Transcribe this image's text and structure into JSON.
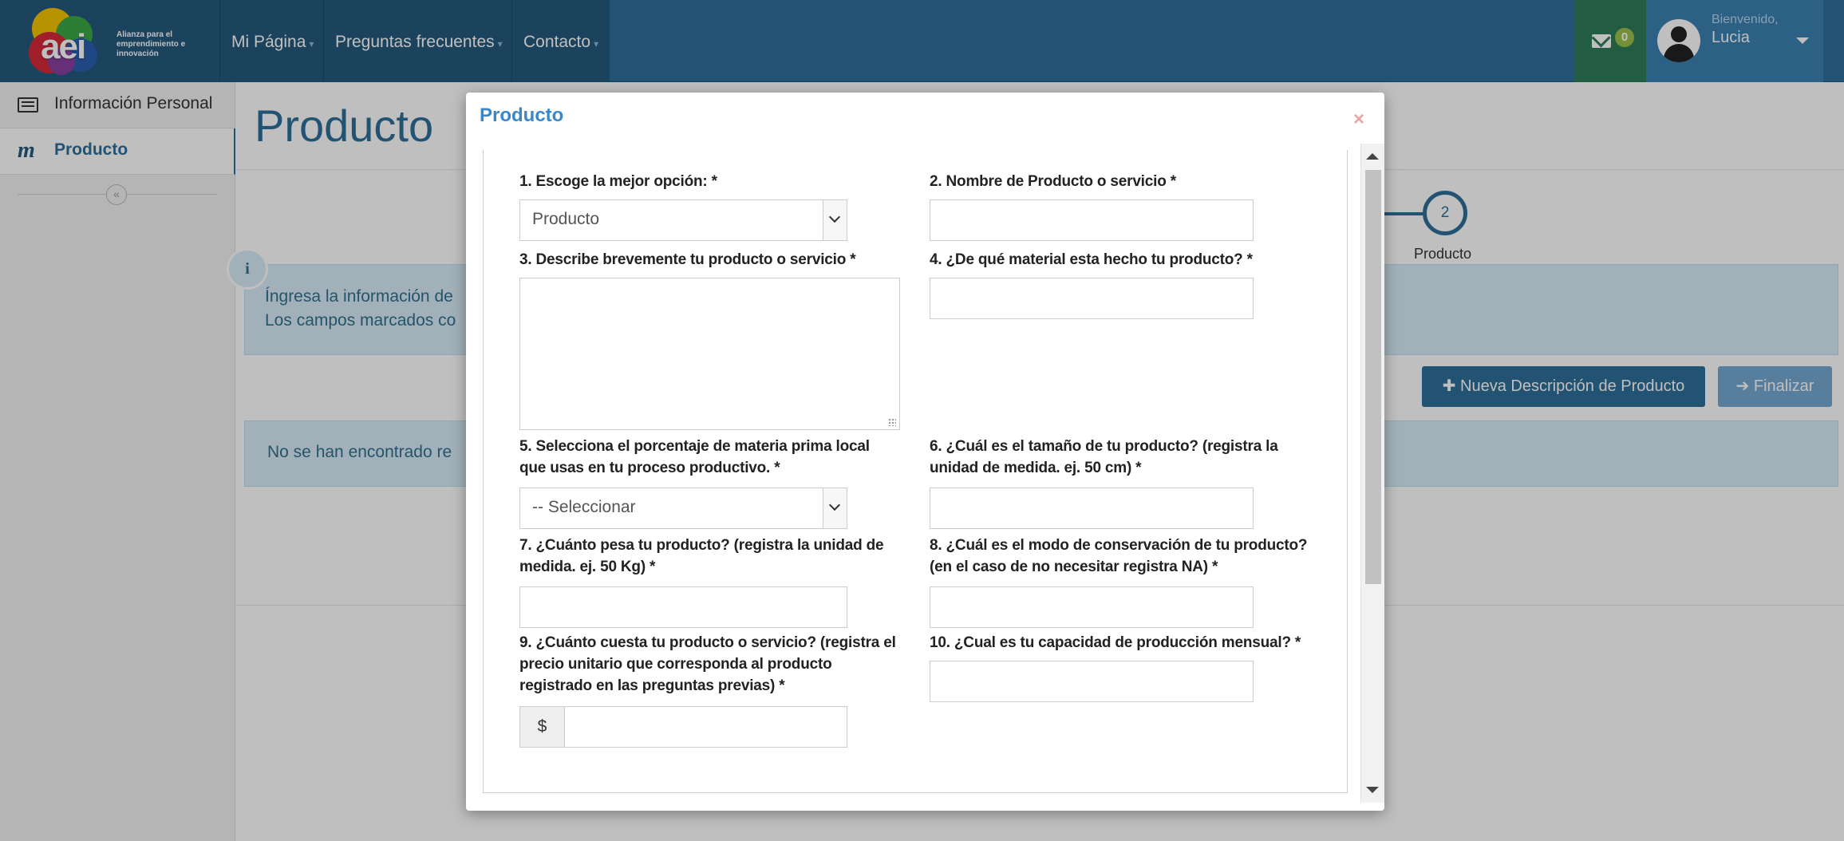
{
  "brand": {
    "logo_text": "aei",
    "tagline": "Alianza para el emprendimiento e innovación"
  },
  "nav": {
    "items": [
      {
        "label": "Mi Página"
      },
      {
        "label": "Preguntas frecuentes"
      },
      {
        "label": "Contacto"
      }
    ],
    "messages_count": "0",
    "welcome": "Bienvenido,",
    "user_name": "Lucia"
  },
  "sidebar": {
    "items": [
      {
        "label": "Información Personal"
      },
      {
        "label": "Producto"
      }
    ],
    "collapse_label": "«"
  },
  "page": {
    "title": "Producto",
    "step_number": "2",
    "step_label": "Producto",
    "info_icon": "i",
    "info_line1": "Íngresa la información de",
    "info_line2": "Los campos marcados co",
    "new_button": "Nueva Descripción de Producto",
    "finish_button": "Finalizar",
    "empty_text": "No se han encontrado re"
  },
  "modal": {
    "title": "Producto",
    "close": "×",
    "questions": {
      "q1": "1. Escoge la mejor opción: *",
      "q1_value": "Producto",
      "q2": "2. Nombre de Producto o servicio *",
      "q3": "3. Describe brevemente tu producto o servicio *",
      "q4": "4. ¿De qué material esta hecho tu producto? *",
      "q5_line1": "5. Selecciona el porcentaje de materia prima local",
      "q5_line2": "que usas en tu proceso productivo. *",
      "q5_value": "-- Seleccionar",
      "q6_line1": "6. ¿Cuál es el tamaño de tu producto? (registra la",
      "q6_line2": "unidad de medida. ej. 50 cm) *",
      "q7_line1": "7. ¿Cuánto pesa tu producto? (registra la unidad de",
      "q7_line2": "medida. ej. 50 Kg) *",
      "q8_line1": "8. ¿Cuál es el modo de conservación de tu producto?",
      "q8_line2": "(en el caso de no necesitar registra NA) *",
      "q9_line1": "9. ¿Cuánto cuesta tu producto o servicio? (registra el",
      "q9_line2": "precio unitario que corresponda al producto",
      "q9_line3": "registrado en las preguntas previas) *",
      "q9_addon": "$",
      "q10": "10. ¿Cual es tu capacidad de producción mensual? *"
    }
  },
  "colors": {
    "nav_bg": "#2f6f99",
    "nav_dark": "#245a7e",
    "messages_bg": "#2f7d57",
    "badge": "#9bc24a",
    "primary_button": "#2f6f99",
    "disabled_button": "#74a8d2",
    "info_bg": "#d9edf7",
    "modal_title": "#3a87c8"
  }
}
